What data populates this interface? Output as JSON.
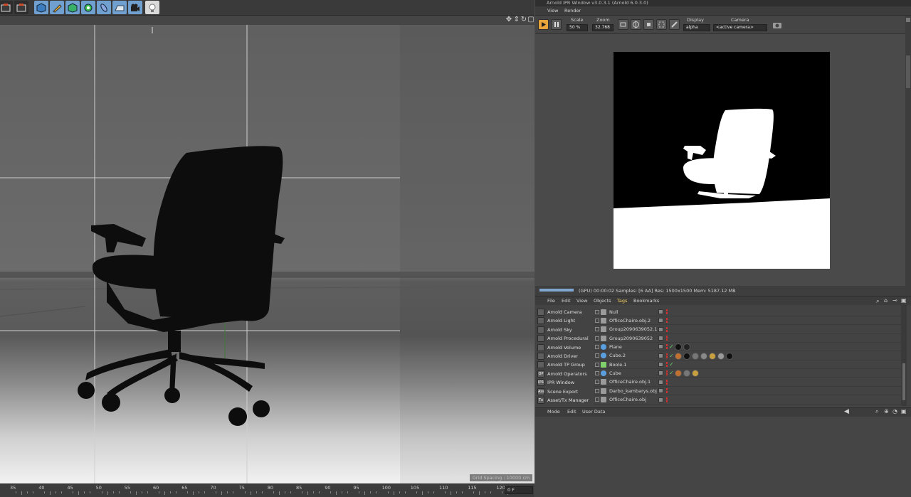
{
  "viewport": {
    "grid_spacing": "Grid Spacing : 10000 cm",
    "ruler_ticks": [
      "35",
      "40",
      "45",
      "50",
      "55",
      "60",
      "65",
      "70",
      "75",
      "80",
      "85",
      "90",
      "95",
      "100",
      "105",
      "110",
      "115",
      "120"
    ],
    "frame_value": "0 F"
  },
  "ipr": {
    "title": "Arnold IPR Window v3.0.3.1 (Arnold 6.0.3.0)",
    "menu": [
      "View",
      "Render"
    ],
    "scale_label": "Scale",
    "scale_value": "50 %",
    "zoom_label": "Zoom",
    "zoom_value": "32.768",
    "display_label": "Display",
    "display_value": "alpha",
    "camera_label": "Camera",
    "camera_value": "<active camera>",
    "status": "(GPU) 00:00:02  Samples: [6 AA]  Res: 1500x1500  Mem: 5187.12 MB",
    "progress": 1.0
  },
  "object_manager": {
    "menu": [
      "File",
      "Edit",
      "View",
      "Objects",
      "Tags",
      "Bookmarks"
    ],
    "arnold_items": [
      "Arnold Camera",
      "Arnold Light",
      "Arnold Sky",
      "Arnold Procedural",
      "Arnold Volume",
      "Arnold Driver",
      "Arnold TP Group",
      "Arnold Operators",
      "IPR Window",
      "Scene Export",
      "Asset/Tx Manager"
    ],
    "arnold_icon_text": [
      "",
      "",
      "",
      "",
      "",
      "",
      "",
      "OP",
      "IPR",
      "Ass",
      "Tx"
    ],
    "objects": [
      "Null",
      "OfficeChaire.obj.2",
      "Group2090639052.1",
      "Group2090639052",
      "Plane",
      "Cube.2",
      "Boole.1",
      "Cube",
      "OfficeChaire.obj.1",
      "Darbo_kambarys.obj",
      "OfficeChaire.obj"
    ]
  },
  "attributes": {
    "menu": [
      "Mode",
      "Edit",
      "User Data"
    ]
  },
  "colors": {
    "accent_orange": "#e8a33a",
    "tags_active": "#f0d060",
    "progress": "#7fa7cf"
  }
}
